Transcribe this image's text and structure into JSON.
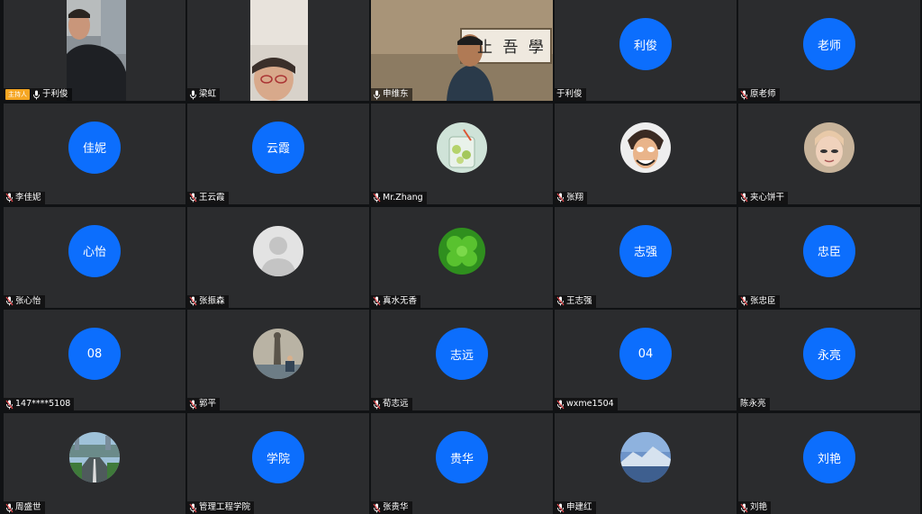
{
  "host_badge": "主持人",
  "tiles": [
    {
      "name": "于利俊",
      "type": "video",
      "mic": "on",
      "host": true
    },
    {
      "name": "梁虹",
      "type": "video",
      "mic": "on"
    },
    {
      "name": "申维东",
      "type": "video",
      "mic": "on",
      "wall_text": "止 吾 學"
    },
    {
      "name": "于利俊",
      "type": "circle",
      "avatar_text": "利俊",
      "mic": "none"
    },
    {
      "name": "原老师",
      "type": "circle",
      "avatar_text": "老师",
      "mic": "muted"
    },
    {
      "name": "李佳妮",
      "type": "circle",
      "avatar_text": "佳妮",
      "mic": "muted"
    },
    {
      "name": "王云霞",
      "type": "circle",
      "avatar_text": "云霞",
      "mic": "muted"
    },
    {
      "name": "Mr.Zhang",
      "type": "photo",
      "icon": "drink-avatar-icon",
      "mic": "muted"
    },
    {
      "name": "张翔",
      "type": "photo",
      "icon": "cartoon-face-avatar-icon",
      "mic": "muted"
    },
    {
      "name": "夹心饼干",
      "type": "photo",
      "icon": "selfie-avatar-icon",
      "mic": "muted"
    },
    {
      "name": "张心怡",
      "type": "circle",
      "avatar_text": "心怡",
      "mic": "muted"
    },
    {
      "name": "张振森",
      "type": "photo",
      "icon": "default-user-avatar-icon",
      "mic": "muted"
    },
    {
      "name": "真水无香",
      "type": "photo",
      "icon": "clover-avatar-icon",
      "mic": "muted"
    },
    {
      "name": "王志强",
      "type": "circle",
      "avatar_text": "志强",
      "mic": "muted"
    },
    {
      "name": "张忠臣",
      "type": "circle",
      "avatar_text": "忠臣",
      "mic": "muted"
    },
    {
      "name": "147****5108",
      "type": "circle",
      "avatar_text": "08",
      "mic": "muted"
    },
    {
      "name": "郭平",
      "type": "photo",
      "icon": "statue-avatar-icon",
      "mic": "muted"
    },
    {
      "name": "荀志远",
      "type": "circle",
      "avatar_text": "志远",
      "mic": "muted"
    },
    {
      "name": "wxme1504",
      "type": "circle",
      "avatar_text": "04",
      "mic": "muted"
    },
    {
      "name": "陈永亮",
      "type": "circle",
      "avatar_text": "永亮",
      "mic": "none"
    },
    {
      "name": "周盛世",
      "type": "photo",
      "icon": "city-road-avatar-icon",
      "mic": "muted"
    },
    {
      "name": "管理工程学院",
      "type": "circle",
      "avatar_text": "学院",
      "mic": "muted"
    },
    {
      "name": "张贵华",
      "type": "circle",
      "avatar_text": "贵华",
      "mic": "muted"
    },
    {
      "name": "申建红",
      "type": "photo",
      "icon": "mountain-avatar-icon",
      "mic": "muted"
    },
    {
      "name": "刘艳",
      "type": "circle",
      "avatar_text": "刘艳",
      "mic": "muted"
    }
  ],
  "colors": {
    "avatar_blue": "#0c6efd",
    "tile_bg": "#2b2c2e",
    "host_badge": "#f5a623",
    "muted_red": "#e5484d"
  }
}
